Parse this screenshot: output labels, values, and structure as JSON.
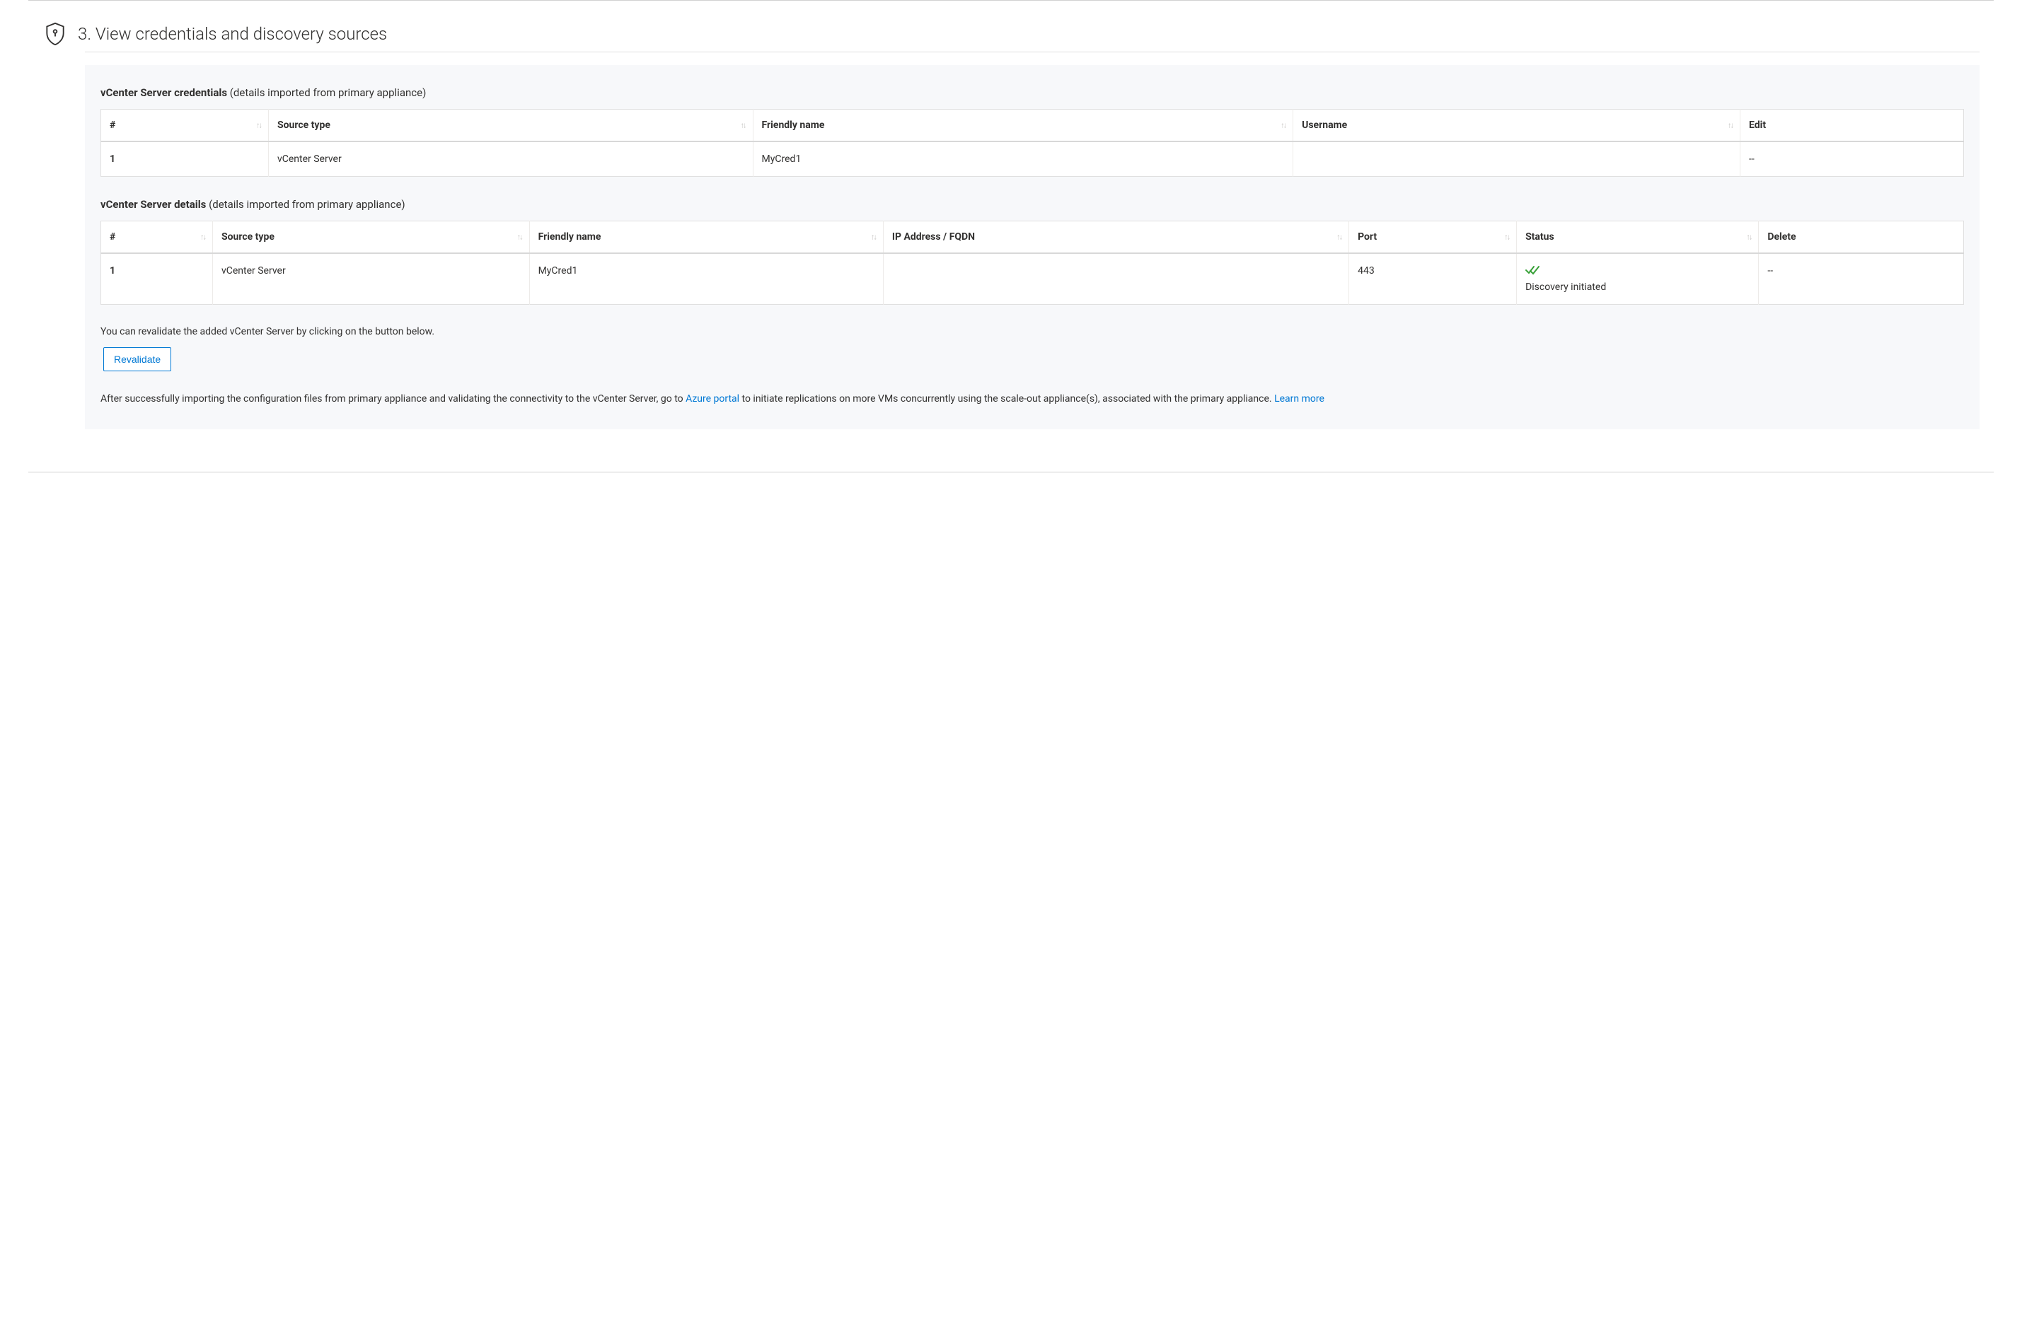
{
  "section": {
    "title": "3. View credentials and discovery sources"
  },
  "credentials": {
    "title_bold": "vCenter Server credentials",
    "title_faint": " (details imported from primary appliance)",
    "columns": {
      "index": "#",
      "source_type": "Source type",
      "friendly_name": "Friendly name",
      "username": "Username",
      "edit": "Edit"
    },
    "rows": [
      {
        "index": "1",
        "source_type": "vCenter Server",
        "friendly_name": "MyCred1",
        "username": "",
        "edit": "--"
      }
    ]
  },
  "details": {
    "title_bold": "vCenter Server details",
    "title_faint": " (details imported from primary appliance)",
    "columns": {
      "index": "#",
      "source_type": "Source type",
      "friendly_name": "Friendly name",
      "ip": "IP Address / FQDN",
      "port": "Port",
      "status": "Status",
      "delete": "Delete"
    },
    "rows": [
      {
        "index": "1",
        "source_type": "vCenter Server",
        "friendly_name": "MyCred1",
        "ip": "",
        "port": "443",
        "status": "Discovery initiated",
        "delete": "--"
      }
    ]
  },
  "revalidate": {
    "info": "You can revalidate the added vCenter Server by clicking on the button below.",
    "button": "Revalidate"
  },
  "footer": {
    "text1": "After successfully importing the configuration files from primary appliance and validating the connectivity to the vCenter Server, go to ",
    "link1": "Azure portal",
    "text2": " to initiate replications on more VMs concurrently using the scale-out appliance(s), associated with the primary appliance. ",
    "link2": "Learn more"
  }
}
